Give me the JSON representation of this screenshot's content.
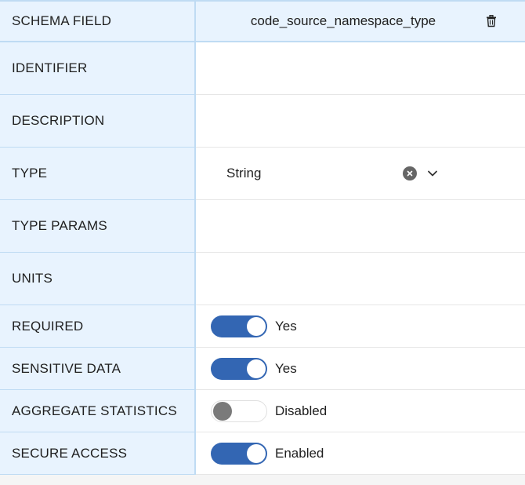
{
  "header": {
    "label": "SCHEMA FIELD",
    "field_name": "code_source_namespace_type"
  },
  "rows": {
    "identifier": {
      "label": "IDENTIFIER",
      "value": ""
    },
    "description": {
      "label": "DESCRIPTION",
      "value": ""
    },
    "type": {
      "label": "TYPE",
      "value": "String"
    },
    "type_params": {
      "label": "TYPE PARAMS",
      "value": ""
    },
    "units": {
      "label": "UNITS",
      "value": ""
    },
    "required": {
      "label": "REQUIRED",
      "state": "on",
      "text": "Yes"
    },
    "sensitive_data": {
      "label": "SENSITIVE DATA",
      "state": "on",
      "text": "Yes"
    },
    "aggregate_statistics": {
      "label": "AGGREGATE STATISTICS",
      "state": "off",
      "text": "Disabled"
    },
    "secure_access": {
      "label": "SECURE ACCESS",
      "state": "on",
      "text": "Enabled"
    }
  },
  "colors": {
    "label_bg": "#e8f3fe",
    "border_blue": "#bfdbf3",
    "toggle_on": "#3366b3",
    "toggle_off_knob": "#7a7a7a"
  },
  "icons": [
    "trash-icon",
    "clear-icon",
    "chevron-down-icon"
  ]
}
